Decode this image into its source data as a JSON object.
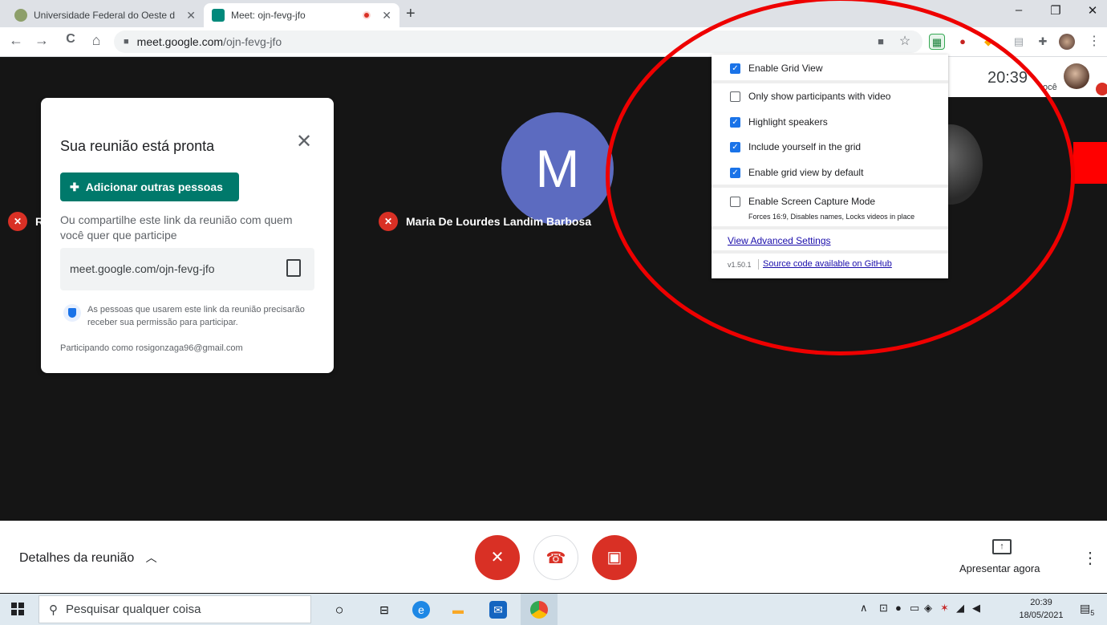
{
  "browser": {
    "tabs": [
      {
        "title": "Universidade Federal do Oeste d",
        "close": "✕"
      },
      {
        "title": "Meet: ojn-fevg-jfo",
        "close": "✕"
      }
    ],
    "new_tab": "+",
    "window_controls": {
      "minimize": "–",
      "restore": "❐",
      "close": "✕"
    },
    "nav": {
      "back": "←",
      "forward": "→",
      "reload": "C",
      "home": "⌂"
    },
    "url_host": "meet.google.com",
    "url_path": "/ojn-fevg-jfo",
    "toolbar_icons": [
      "camera-icon",
      "star-icon",
      "grid-view-extension-icon",
      "apple-extension-icon",
      "shield-extension-icon",
      "extension-icon",
      "puzzle-icon",
      "profile-icon",
      "menu-icon"
    ],
    "more": "⋮"
  },
  "meet": {
    "participants": [
      {
        "initial": "M",
        "name": "Maria De Lourdes Landim Barbosa"
      },
      {
        "name": "R"
      }
    ],
    "clock": "20:39",
    "self_label": "ocê"
  },
  "card": {
    "title": "Sua reunião está pronta",
    "close": "✕",
    "add_button": "Adicionar outras pessoas",
    "share_text": "Ou compartilhe este link da reunião com quem você quer que participe",
    "link": "meet.google.com/ojn-fevg-jfo",
    "permission_text": "As pessoas que usarem este link da reunião precisarão receber sua permissão para participar.",
    "joined_as": "Participando como rosigonzaga96@gmail.com"
  },
  "popup": {
    "options": [
      {
        "label": "Enable Grid View",
        "checked": true
      },
      {
        "label": "Only show participants with video",
        "checked": false
      },
      {
        "label": "Highlight speakers",
        "checked": true
      },
      {
        "label": "Include yourself in the grid",
        "checked": true
      },
      {
        "label": "Enable grid view by default",
        "checked": true
      },
      {
        "label": "Enable Screen Capture Mode",
        "checked": false
      }
    ],
    "capture_subtext": "Forces 16:9, Disables names, Locks videos in place",
    "advanced_link": "View Advanced Settings",
    "version": "v1.50.1",
    "source_link": "Source code available on GitHub"
  },
  "bottom": {
    "details_label": "Detalhes da reunião",
    "present_label": "Apresentar agora"
  },
  "taskbar": {
    "search_placeholder": "Pesquisar qualquer coisa",
    "time": "20:39",
    "date": "18/05/2021",
    "notification_count": "5"
  },
  "colors": {
    "meet_bg": "#151515",
    "accent_teal": "#00796b",
    "mute_red": "#d93025",
    "checkbox_blue": "#1a73e8",
    "annotation_red": "#ee0000"
  }
}
